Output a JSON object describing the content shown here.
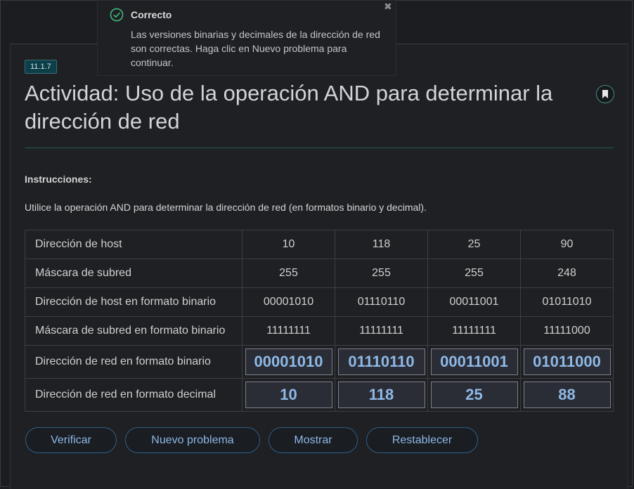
{
  "toast": {
    "title": "Correcto",
    "message": "Las versiones binarias y decimales de la dirección de red son correctas. Haga clic en Nuevo problema para continuar.",
    "close": "✖"
  },
  "activity": {
    "badge": "11.1.7",
    "title": "Actividad: Uso de la operación AND para determinar la dirección de red",
    "bookmark_icon": "bookmark-icon"
  },
  "instructions": {
    "label": "Instrucciones:",
    "text": "Utilice la operación AND para determinar la dirección de red (en formatos binario y decimal)."
  },
  "table": {
    "rows": [
      {
        "label": "Dirección de host",
        "values": [
          "10",
          "118",
          "25",
          "90"
        ]
      },
      {
        "label": "Máscara de subred",
        "values": [
          "255",
          "255",
          "255",
          "248"
        ]
      },
      {
        "label": "Dirección de host en formato binario",
        "values": [
          "00001010",
          "01110110",
          "00011001",
          "01011010"
        ]
      },
      {
        "label": "Máscara de subred en formato binario",
        "values": [
          "11111111",
          "11111111",
          "11111111",
          "11111000"
        ]
      },
      {
        "label": "Dirección de red en formato binario",
        "values": [
          "00001010",
          "01110110",
          "00011001",
          "01011000"
        ]
      },
      {
        "label": "Dirección de red en formato decimal",
        "values": [
          "10",
          "118",
          "25",
          "88"
        ]
      }
    ]
  },
  "buttons": {
    "verify": "Verificar",
    "new_problem": "Nuevo problema",
    "show": "Mostrar",
    "reset": "Restablecer"
  },
  "colors": {
    "accent": "#8db8e6",
    "success": "#3fb97a",
    "badge_bg": "#0d3f4a"
  }
}
